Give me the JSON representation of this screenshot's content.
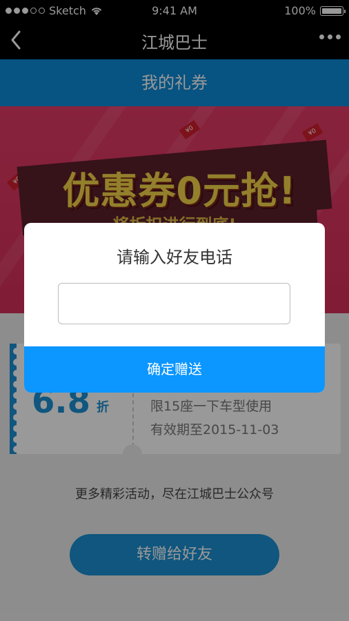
{
  "status_bar": {
    "carrier": "Sketch",
    "time": "9:41 AM",
    "battery": "100%"
  },
  "nav": {
    "title": "江城巴士",
    "back_icon": "chevron-left-icon",
    "more_icon": "more-dots-icon"
  },
  "subheader": {
    "title": "我的礼券"
  },
  "banner": {
    "headline": "优惠券0元抢!",
    "subline": "将折扣进行到底!",
    "tag_text": "¥0"
  },
  "coupon": {
    "value": "6.8",
    "unit": "折",
    "restriction": "限15座一下车型使用",
    "validity": "有效期至2015-11-03"
  },
  "promo_text": "更多精彩活动，尽在江城巴士公众号",
  "gift_button": "转赠给好友",
  "dialog": {
    "title": "请输入好友电话",
    "input_value": "",
    "confirm_label": "确定赠送"
  },
  "colors": {
    "primary_blue": "#0c8ad8",
    "confirm_blue": "#0c96ff",
    "banner_red": "#e33b66"
  }
}
